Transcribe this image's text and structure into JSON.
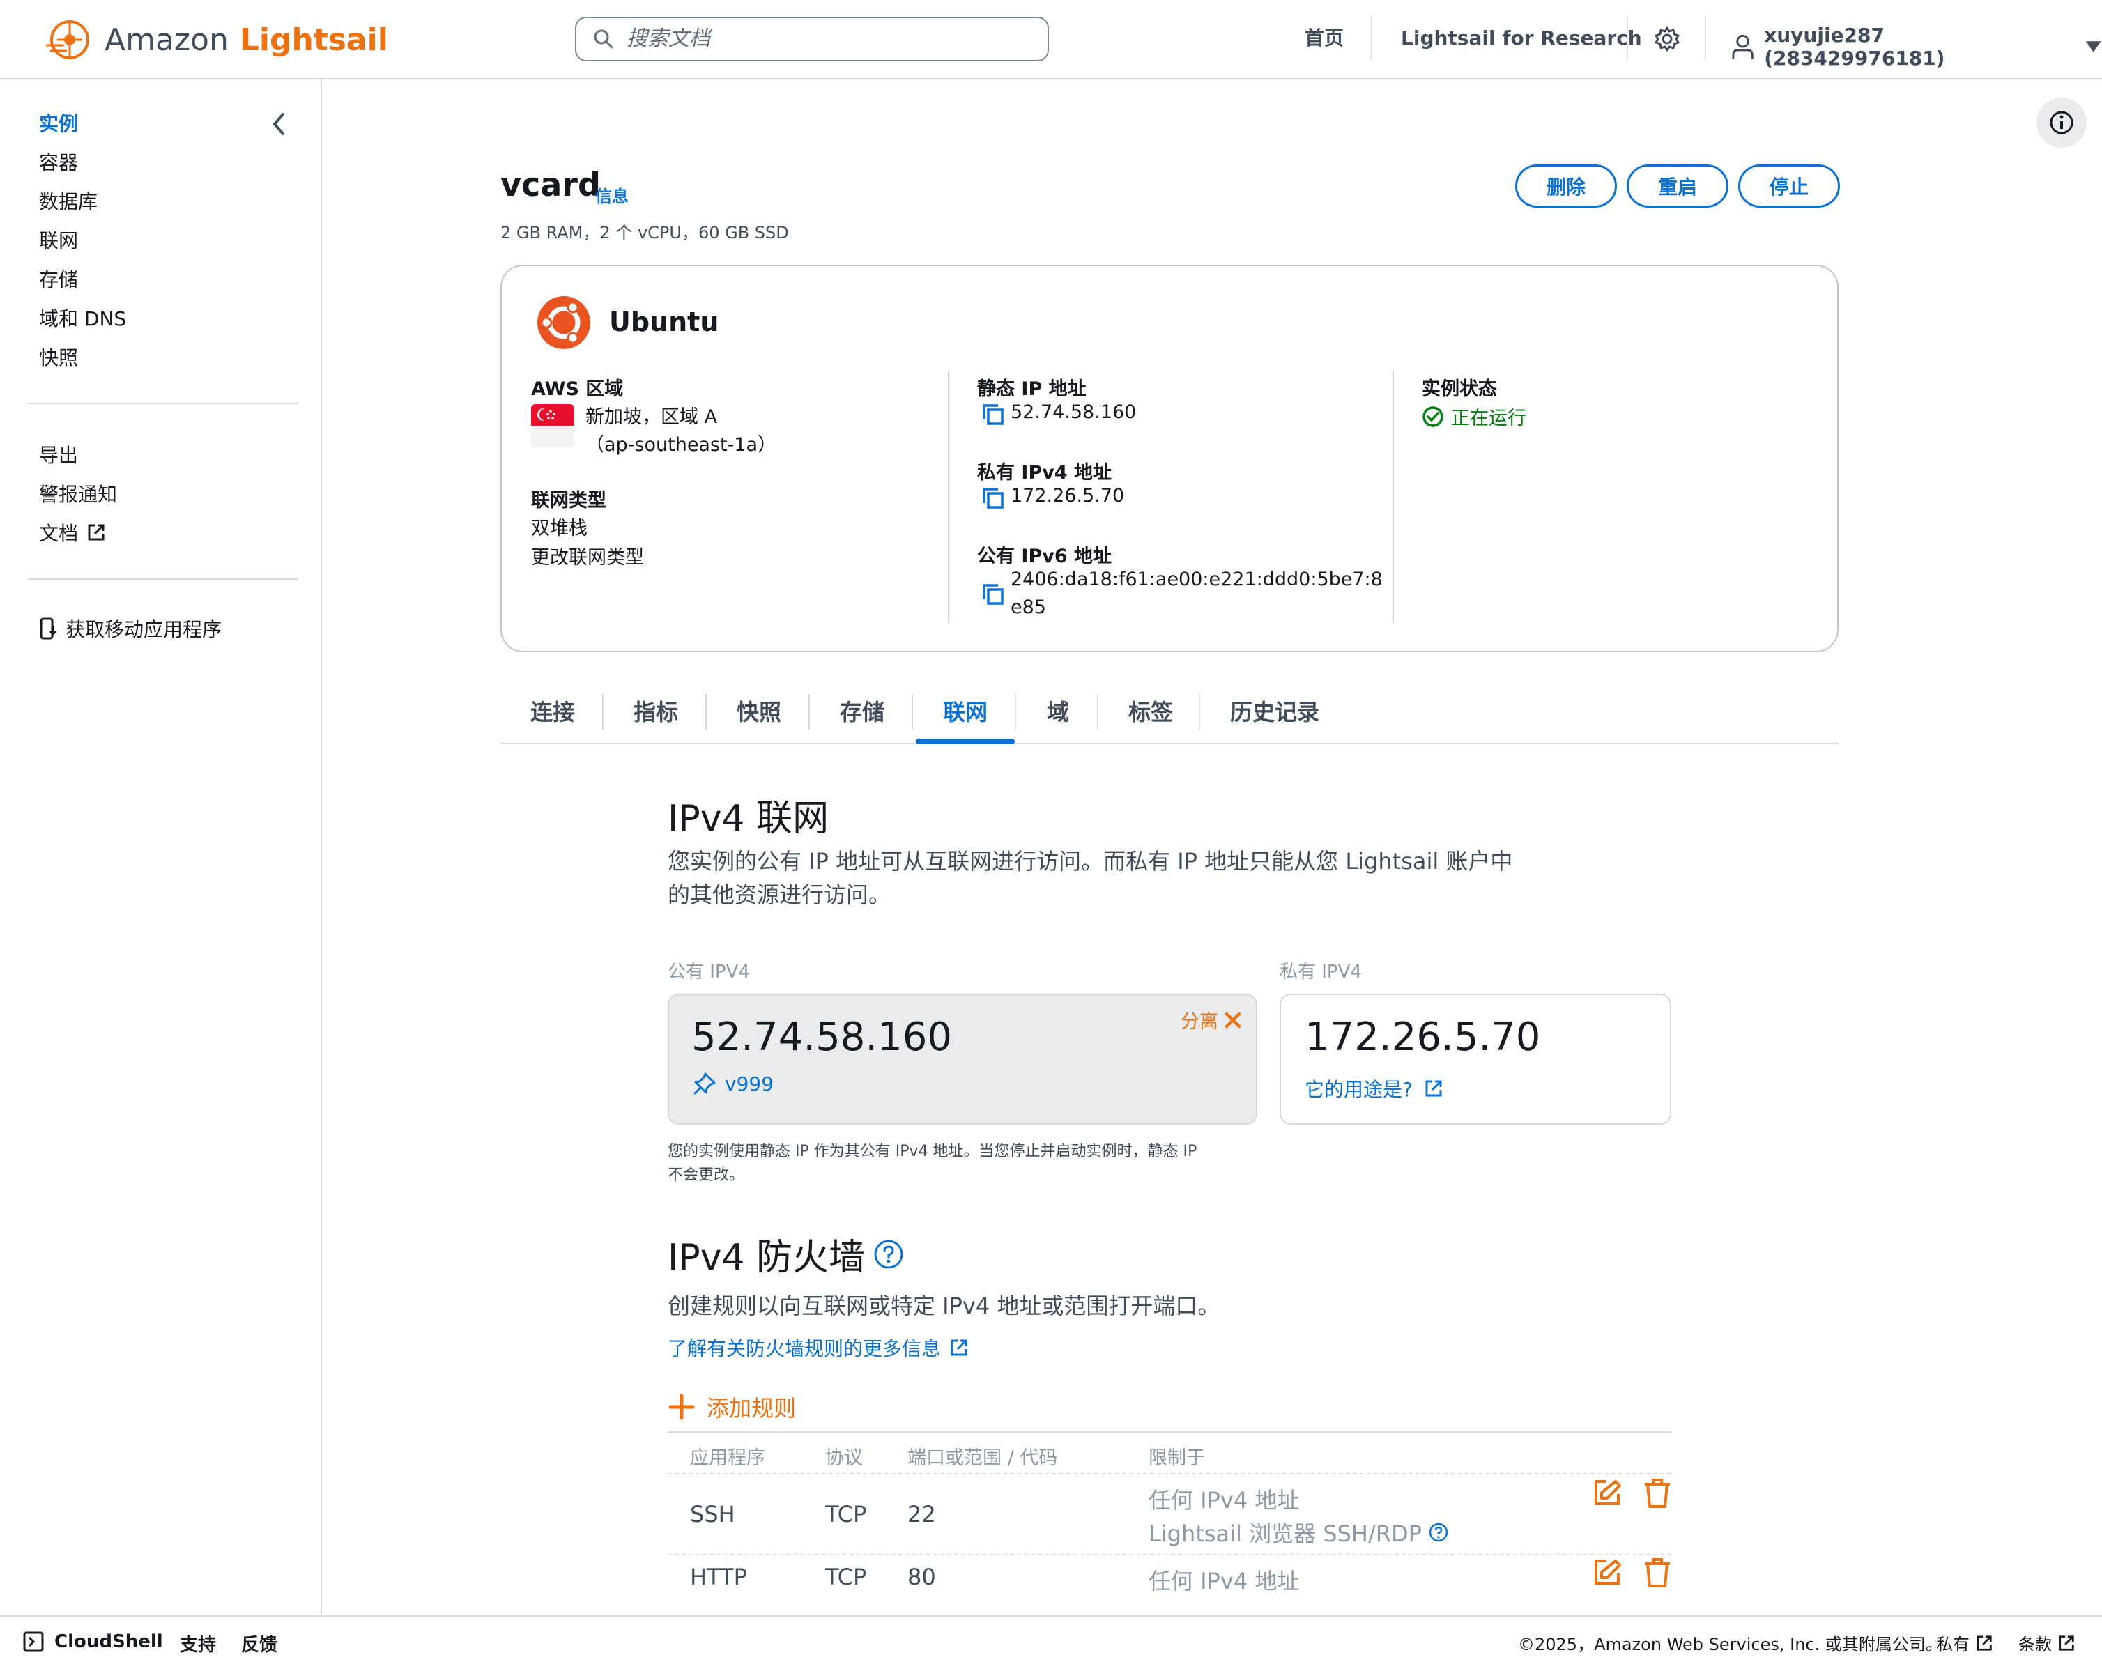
{
  "topnav": {
    "logo_amazon": "Amazon",
    "logo_lightsail": "Lightsail",
    "search_placeholder": "搜索文档",
    "home": "首页",
    "research": "Lightsail for Research",
    "account": "xuyujie287 (283429976181)"
  },
  "sidebar": {
    "items": [
      "实例",
      "容器",
      "数据库",
      "联网",
      "存储",
      "域和 DNS",
      "快照"
    ],
    "secondary": [
      "导出",
      "警报通知",
      "文档"
    ],
    "mobile_app": "获取移动应用程序"
  },
  "instance": {
    "name": "vcard",
    "info": "信息",
    "specs": "2 GB RAM，2 个 vCPU，60 GB SSD",
    "buttons": {
      "delete": "删除",
      "restart": "重启",
      "stop": "停止"
    },
    "os": "Ubuntu",
    "region_label": "AWS 区域",
    "region_value": "新加坡，区域 A",
    "region_code": "（ap-southeast-1a）",
    "network_type_label": "联网类型",
    "network_type_value": "双堆栈",
    "change_network_type": "更改联网类型",
    "static_ip_label": "静态 IP 地址",
    "static_ip": "52.74.58.160",
    "private_ipv4_label": "私有 IPv4 地址",
    "private_ipv4": "172.26.5.70",
    "public_ipv6_label": "公有 IPv6 地址",
    "public_ipv6_line1": "2406:da18:f61:ae00:e221:ddd0:5be7:8",
    "public_ipv6_line2": "e85",
    "state_label": "实例状态",
    "state_value": "正在运行"
  },
  "tabs": [
    "连接",
    "指标",
    "快照",
    "存储",
    "联网",
    "域",
    "标签",
    "历史记录"
  ],
  "networking": {
    "title": "IPv4 联网",
    "desc_line1": "您实例的公有 IP 地址可从互联网进行访问。而私有 IP 地址只能从您 Lightsail 账户中",
    "desc_line2": "的其他资源进行访问。",
    "public_label": "公有 IPV4",
    "private_label": "私有 IPV4",
    "public_ip": "52.74.58.160",
    "detach": "分离",
    "static_name": "v999",
    "private_ip": "172.26.5.70",
    "what_for": "它的用途是?",
    "note_line1": "您的实例使用静态 IP 作为其公有 IPv4 地址。当您停止并启动实例时，静态 IP",
    "note_line2": "不会更改。"
  },
  "firewall": {
    "title": "IPv4 防火墙",
    "desc": "创建规则以向互联网或特定 IPv4 地址或范围打开端口。",
    "learn_more": "了解有关防火墙规则的更多信息",
    "add_rule": "添加规则",
    "headers": [
      "应用程序",
      "协议",
      "端口或范围 / 代码",
      "限制于"
    ],
    "rows": [
      {
        "app": "SSH",
        "protocol": "TCP",
        "port": "22",
        "restrict1": "任何 IPv4 地址",
        "restrict2": "Lightsail 浏览器 SSH/RDP"
      },
      {
        "app": "HTTP",
        "protocol": "TCP",
        "port": "80",
        "restrict1": "任何 IPv4 地址",
        "restrict2": ""
      }
    ]
  },
  "footer": {
    "cloudshell": "CloudShell",
    "support": "支持",
    "feedback": "反馈",
    "copyright": "©2025，Amazon Web Services, Inc. 或其附属公司。",
    "privacy": "私有",
    "terms": "条款"
  },
  "colors": {
    "accent": "#0972d3",
    "brand": "#ec7211",
    "running": "#037f0c"
  }
}
